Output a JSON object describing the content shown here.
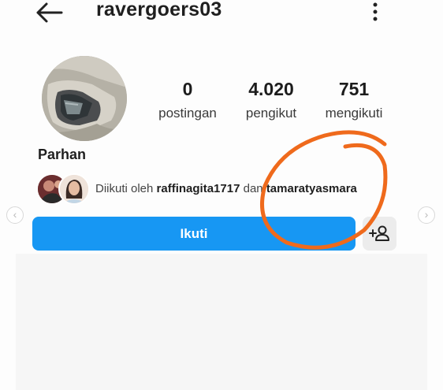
{
  "header": {
    "username": "ravergoers03",
    "back_icon": "arrow-left-icon",
    "menu_icon": "more-vertical-icon"
  },
  "profile": {
    "name": "Parhan",
    "stats": [
      {
        "value": "0",
        "label": "postingan"
      },
      {
        "value": "4.020",
        "label": "pengikut"
      },
      {
        "value": "751",
        "label": "mengikuti"
      }
    ],
    "followed_by": {
      "prefix": "Diikuti oleh",
      "user1": "raffinagita1717",
      "conjunction": "dan",
      "user2": "tamaratyasmara"
    }
  },
  "actions": {
    "follow_label": "Ikuti",
    "suggest_icon": "add-person-icon"
  },
  "colors": {
    "accent": "#1797f3",
    "annotation": "#ef6a1c"
  }
}
